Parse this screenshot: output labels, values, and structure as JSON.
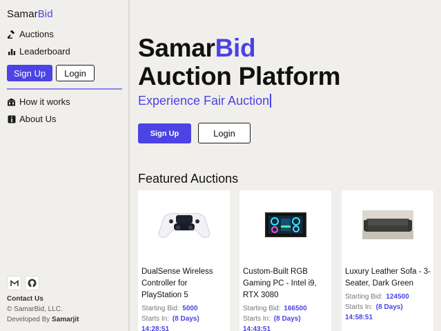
{
  "brand": {
    "name_part1": "Samar",
    "name_part2": "Bid"
  },
  "sidebar": {
    "nav": [
      {
        "label": "Auctions",
        "icon": "gavel-icon"
      },
      {
        "label": "Leaderboard",
        "icon": "bar-chart-icon"
      }
    ],
    "signup_label": "Sign Up",
    "login_label": "Login",
    "info_nav": [
      {
        "label": "How it works",
        "icon": "building-icon"
      },
      {
        "label": "About Us",
        "icon": "info-icon"
      }
    ],
    "socials": [
      {
        "icon": "gmail-icon"
      },
      {
        "icon": "github-icon"
      }
    ],
    "footer": {
      "contact": "Contact Us",
      "copyright": "© SamarBid, LLC.",
      "developed_prefix": "Developed By",
      "developer": "Samarjit"
    }
  },
  "hero": {
    "title_part1": "Samar",
    "title_part2": "Bid",
    "title_line2": "Auction Platform",
    "subtitle": "Experience Fair Auction",
    "signup_label": "Sign Up",
    "login_label": "Login"
  },
  "featured": {
    "heading": "Featured Auctions",
    "starting_bid_label": "Starting Bid:",
    "starts_in_label": "Starts In:",
    "cards": [
      {
        "title": "DualSense Wireless Controller for PlayStation 5",
        "starting_bid": "5000",
        "days": "(8 Days)",
        "time": "14:28:51",
        "image": "controller-image"
      },
      {
        "title": "Custom-Built RGB Gaming PC - Intel i9, RTX 3080",
        "starting_bid": "166500",
        "days": "(8 Days)",
        "time": "14:43:51",
        "image": "gaming-pc-image"
      },
      {
        "title": "Luxury Leather Sofa - 3-Seater, Dark Green",
        "starting_bid": "124500",
        "days": "(8 Days)",
        "time": "14:58:51",
        "image": "sofa-image"
      }
    ]
  },
  "colors": {
    "accent": "#4b43e3",
    "background": "#f1efec"
  }
}
